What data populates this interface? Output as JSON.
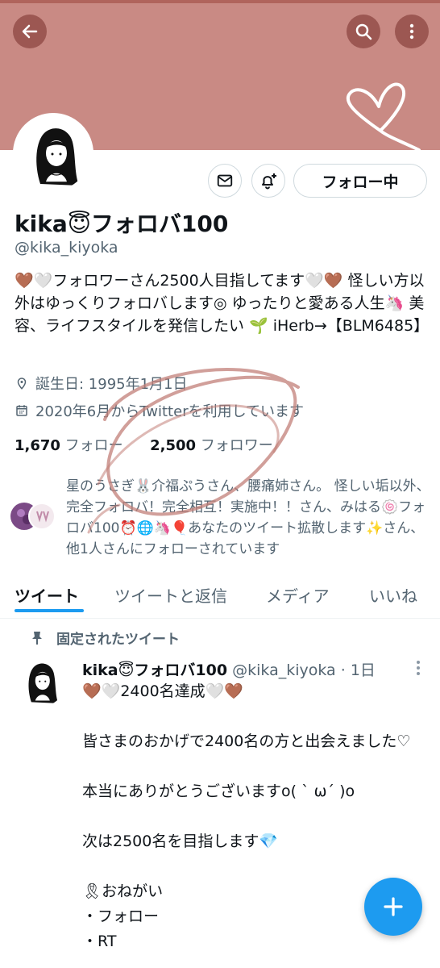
{
  "colors": {
    "banner": "#c98a84",
    "accent": "#1d9bf0",
    "secondary_text": "#536471"
  },
  "header": {
    "back_icon": "arrow-left-icon",
    "search_icon": "search-icon",
    "more_icon": "more-vertical-icon"
  },
  "profile": {
    "display_name": "kika😇フォロバ100",
    "handle": "@kika_kiyoka",
    "bio": "🤎🤍フォロワーさん2500人目指してます🤍🤎 怪しい方以外はゆっくりフォロバします◎ ゆったりと愛ある人生🦄 美容、ライフスタイルを発信したい 🌱 iHerb→【BLM6485】",
    "birthday": "誕生日: 1995年1月1日",
    "joined": "2020年6月からTwitterを利用しています",
    "following_count": "1,670",
    "following_label": "フォロー",
    "followers_count": "2,500",
    "followers_label": "フォロワー"
  },
  "actions": {
    "follow_label": "フォロー中",
    "message_icon": "mail-icon",
    "notify_icon": "bell-plus-icon"
  },
  "followers_you_know": "星のうさぎ🐰介福ぷうさん、腰痛姉さん。 怪しい垢以外、完全フォロバ！完全相互！実施中！！さん、みはる🍥フォロバ100⏰🌐🦄🎈あなたのツイート拡散します✨さん、他1人さんにフォローされています",
  "tabs": [
    {
      "label": "ツイート",
      "active": true
    },
    {
      "label": "ツイートと返信",
      "active": false
    },
    {
      "label": "メディア",
      "active": false
    },
    {
      "label": "いいね",
      "active": false
    }
  ],
  "pinned": {
    "label": "固定されたツイート",
    "author_name": "kika😇フォロバ100",
    "author_handle": "@kika_kiyoka",
    "time": "· 1日",
    "body": "🤎🤍2400名達成🤍🤎\n\n皆さまのおかげで2400名の方と出会えました♡\n\n本当にありがとうございますo( ˋ ω´ )o\n\n次は2500名を目指します💎\n\n🎗おねがい\n・フォロー\n・RT"
  },
  "fab": {
    "icon": "plus-icon"
  }
}
